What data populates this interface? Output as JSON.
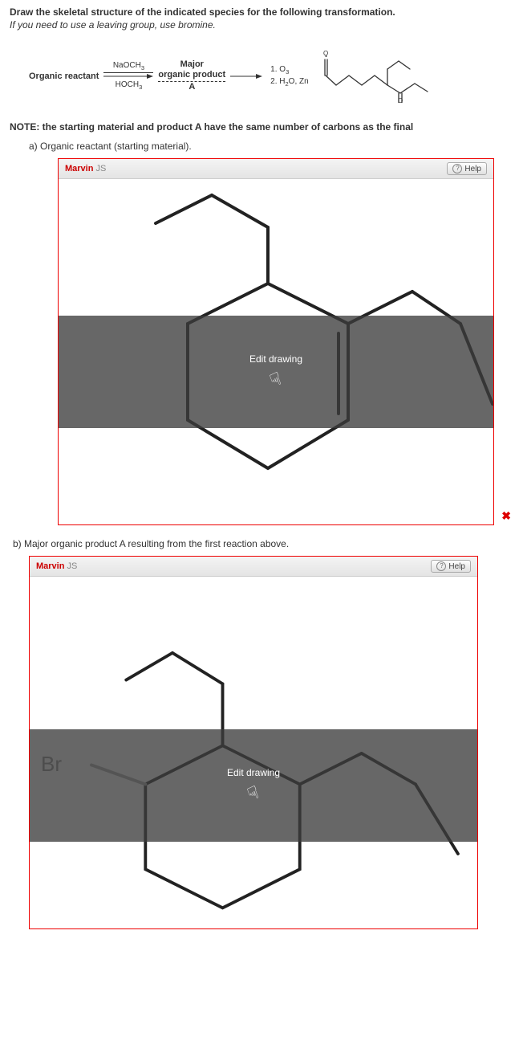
{
  "instructions": {
    "line1": "Draw the skeletal structure of the indicated species for the following transformation.",
    "line2": "If you need to use a leaving group, use bromine."
  },
  "reaction": {
    "reactant_label": "Organic reactant",
    "arrow1_top": "NaOCH",
    "arrow1_top_sub": "3",
    "arrow1_bottom": "HOCH",
    "arrow1_bottom_sub": "3",
    "product_label_top": "Major",
    "product_label_mid": "organic product",
    "product_label_bot": "A",
    "cond1": "1. O",
    "cond1_sub": "3",
    "cond2a": "2. H",
    "cond2a_sub": "2",
    "cond2b": "O, Zn"
  },
  "note": "NOTE: the starting material and product A have the same number of carbons as the final",
  "parts": {
    "a_label": "a) Organic reactant (starting material).",
    "b_label": "b) Major organic product A resulting from the first reaction above."
  },
  "marvin": {
    "title_red": "Marvin",
    "title_grey": " JS",
    "help": "Help",
    "edit": "Edit drawing",
    "br": "Br"
  }
}
